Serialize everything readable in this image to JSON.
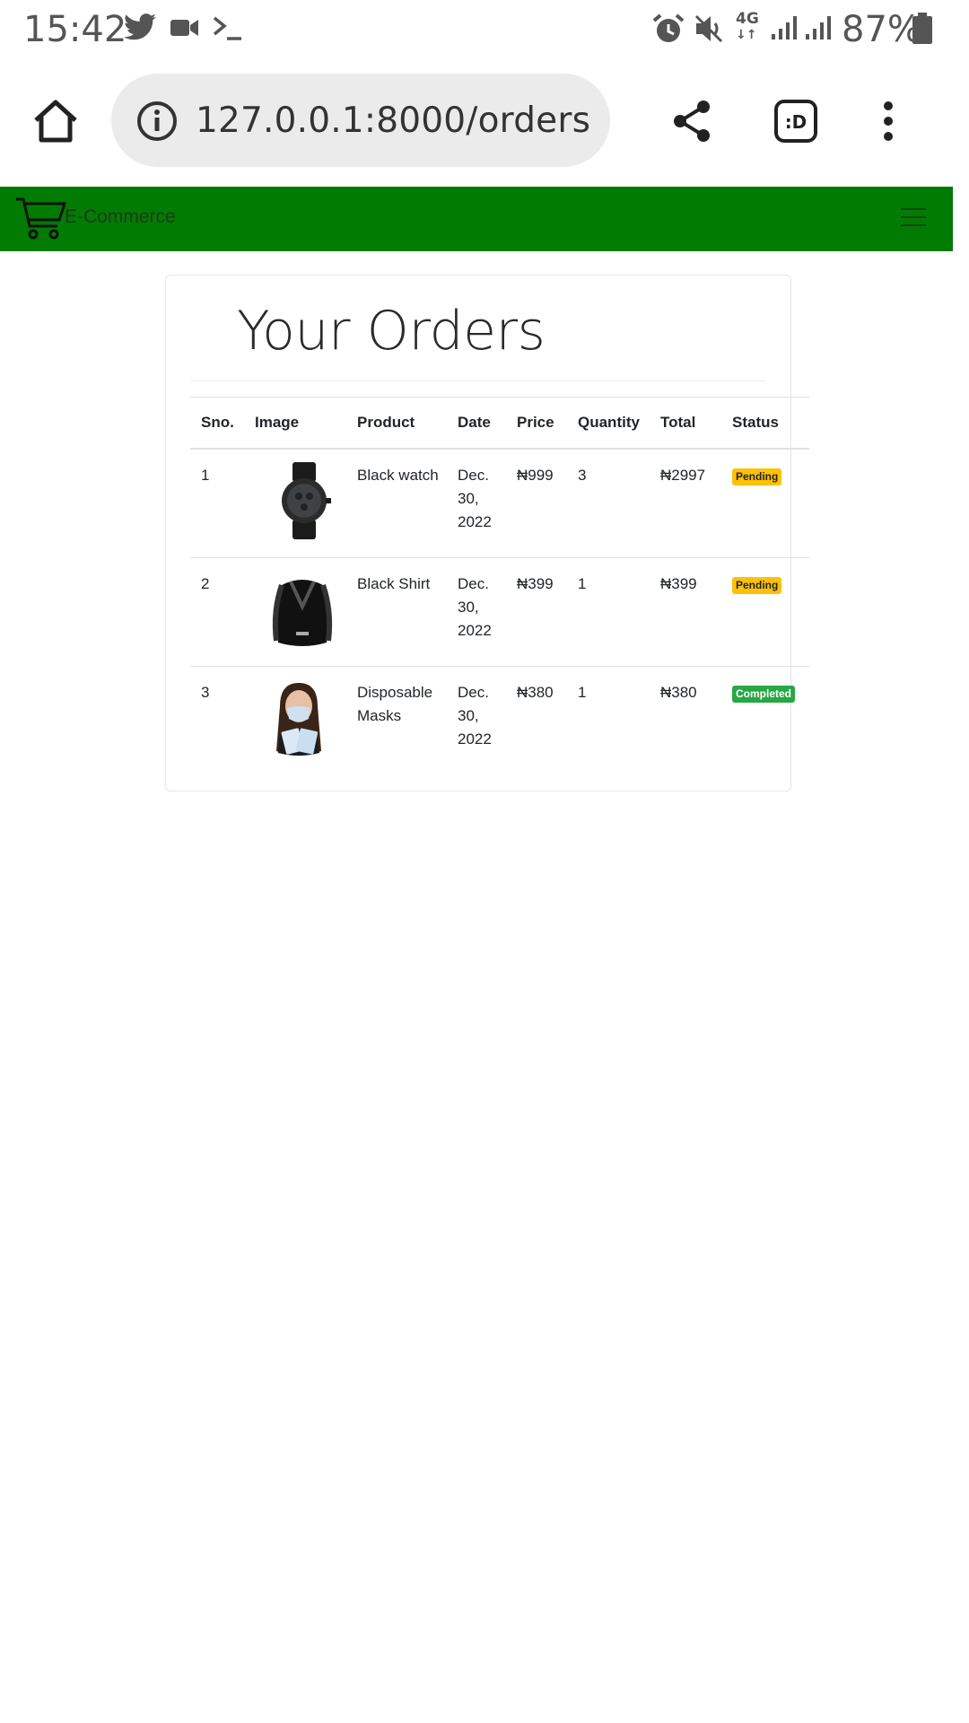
{
  "status_bar": {
    "time": "15:42",
    "network_label": "4G",
    "battery": "87%",
    "icons": [
      "twitter-icon",
      "video-icon",
      "terminal-icon",
      "alarm-icon",
      "mute-icon",
      "signal-icon",
      "battery-icon"
    ]
  },
  "browser": {
    "url": "127.0.0.1:8000/orders",
    "icons": [
      "home-icon",
      "info-icon",
      "share-icon",
      "tab-switcher-icon",
      "more-icon"
    ]
  },
  "navbar": {
    "brand": "E-Commerce",
    "background": "#027b02"
  },
  "page": {
    "title": "Your Orders"
  },
  "orders_table": {
    "headers": [
      "Sno.",
      "Image",
      "Product",
      "Date",
      "Price",
      "Quantity",
      "Total",
      "Status"
    ],
    "rows": [
      {
        "sno": "1",
        "image": "watch-image",
        "product": "Black watch",
        "date": "Dec. 30, 2022",
        "price": "₦999",
        "quantity": "3",
        "total": "₦2997",
        "status": "Pending"
      },
      {
        "sno": "2",
        "image": "shirt-image",
        "product": "Black Shirt",
        "date": "Dec. 30, 2022",
        "price": "₦399",
        "quantity": "1",
        "total": "₦399",
        "status": "Pending"
      },
      {
        "sno": "3",
        "image": "mask-image",
        "product": "Disposable Masks",
        "date": "Dec. 30, 2022",
        "price": "₦380",
        "quantity": "1",
        "total": "₦380",
        "status": "Completed"
      }
    ]
  },
  "colors": {
    "pending": "#ffc107",
    "completed": "#28a745"
  }
}
